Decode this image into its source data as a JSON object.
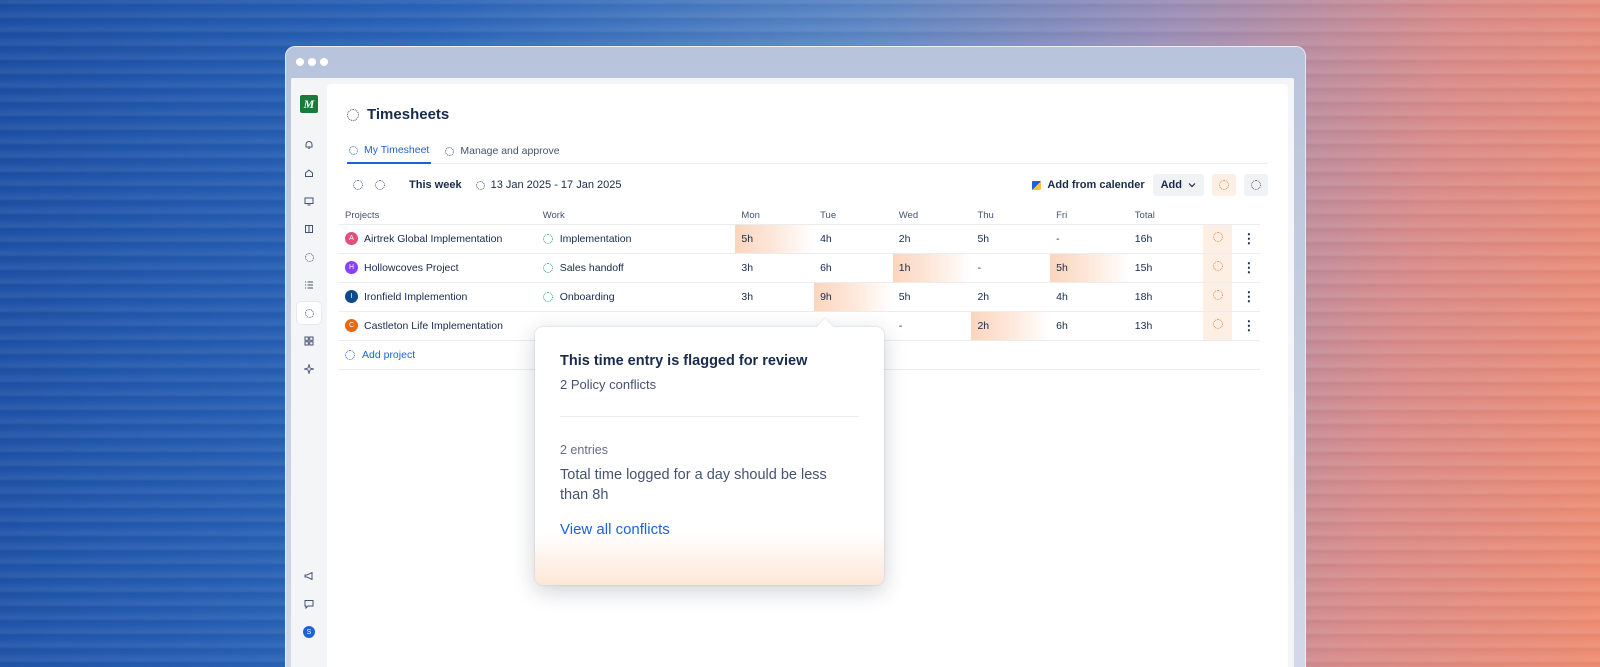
{
  "app": {
    "logo_letter": "M",
    "page_title": "Timesheets"
  },
  "rail": {
    "icons": [
      "bell-icon",
      "home-icon",
      "monitor-icon",
      "book-icon",
      "circle-icon",
      "list-icon",
      "timesheet-icon",
      "apps-icon",
      "sparkle-icon",
      "megaphone-icon",
      "chat-icon",
      "user-icon"
    ],
    "user_initial": "S"
  },
  "tabs": [
    {
      "label": "My Timesheet",
      "active": true
    },
    {
      "label": "Manage and approve",
      "active": false
    }
  ],
  "toolbar": {
    "week_label": "This week",
    "date_range": "13 Jan 2025 - 17 Jan 2025",
    "add_from_calendar": "Add from calender",
    "add_label": "Add"
  },
  "table": {
    "headers": [
      "Projects",
      "Work",
      "Mon",
      "Tue",
      "Wed",
      "Thu",
      "Fri",
      "Total"
    ],
    "rows": [
      {
        "initial": "A",
        "avatar_color": "#e0507a",
        "project": "Airtrek Global Implementation",
        "work": "Implementation",
        "mon": "5h",
        "tue": "4h",
        "wed": "2h",
        "thu": "5h",
        "fri": "-",
        "total": "16h"
      },
      {
        "initial": "H",
        "avatar_color": "#8a3ffc",
        "project": "Hollowcoves  Project",
        "work": "Sales handoff",
        "mon": "3h",
        "tue": "6h",
        "wed": "1h",
        "thu": "-",
        "fri": "5h",
        "total": "15h"
      },
      {
        "initial": "I",
        "avatar_color": "#0c4a8c",
        "project": "Ironfield Implemention",
        "work": "Onboarding",
        "mon": "3h",
        "tue": "9h",
        "wed": "5h",
        "thu": "2h",
        "fri": "4h",
        "total": "18h"
      },
      {
        "initial": "C",
        "avatar_color": "#e56910",
        "project": "Castleton Life  Implementation",
        "work": "",
        "mon": "",
        "tue": "",
        "wed": "-",
        "thu": "2h",
        "fri": "6h",
        "total": "13h"
      }
    ],
    "add_project": "Add project"
  },
  "popover": {
    "title": "This time entry is flagged for review",
    "subtitle": "2 Policy conflicts",
    "entries": "2 entries",
    "message": "Total time logged for a day should be less than 8h",
    "link": "View all conflicts"
  },
  "colors": {
    "accent": "#1d62d6",
    "flag_highlight": "#fbd5bd",
    "flag_icon": "#f0803c"
  }
}
